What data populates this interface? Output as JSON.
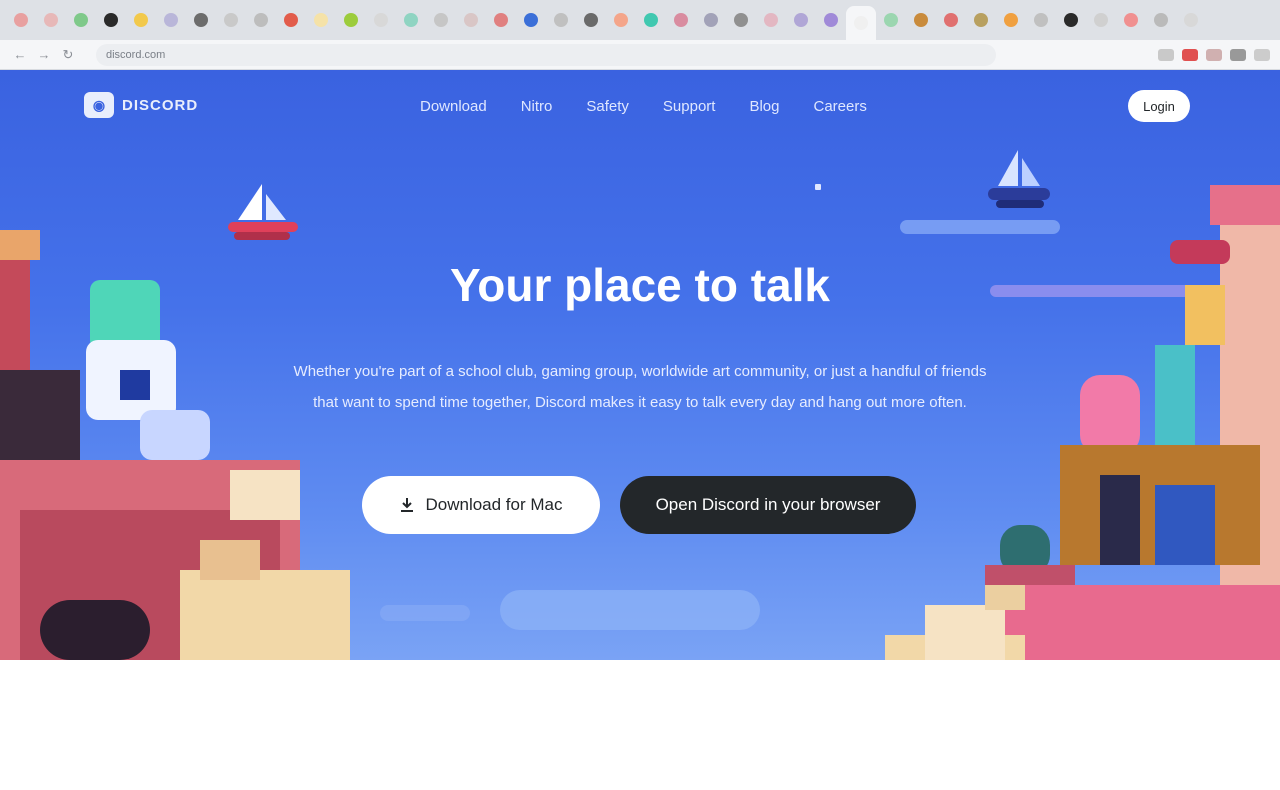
{
  "browser": {
    "tab_favicons": [
      "#e8a0a0",
      "#e7b8b8",
      "#7fc98a",
      "#2a2a2a",
      "#f2c94c",
      "#b9b6d9",
      "#6c6c6c",
      "#c9c9c9",
      "#bdbdbd",
      "#e25c4b",
      "#f5e2a8",
      "#9ccc3c",
      "#d8d8d8",
      "#8fd4c2",
      "#c6c6c6",
      "#d9c6c6",
      "#e08080",
      "#3b6fd8",
      "#c0c0c0",
      "#6a6a6a",
      "#f4a58a",
      "#40c8b0",
      "#d98ca0",
      "#a2a2b8",
      "#909090",
      "#e3b7c2",
      "#b0a6d6",
      "#a08ad8",
      "#f0f0f0",
      "#9bd6b0",
      "#c98b3c",
      "#e07070",
      "#b8a060",
      "#f0a040",
      "#c0c0c0",
      "#2a2a2a",
      "#d0d0d0",
      "#f09090",
      "#bababa",
      "#d8d8d8"
    ],
    "active_tab_index": 28,
    "url": "discord.com",
    "extension_colors": [
      "#c9c9c9",
      "#e05050",
      "#d0b0b0",
      "#999999",
      "#cccccc"
    ]
  },
  "site": {
    "logo_text": "DISCORD",
    "nav": [
      "Download",
      "Nitro",
      "Safety",
      "Support",
      "Blog",
      "Careers"
    ],
    "login_label": "Login"
  },
  "hero": {
    "title": "Your place to talk",
    "subtitle": "Whether you're part of a school club, gaming group, worldwide art community, or just a handful of friends that want to spend time together, Discord makes it easy to talk every day and hang out more often.",
    "download_label": "Download for Mac",
    "open_label": "Open Discord in your browser"
  },
  "colors": {
    "hero_top": "#3a62e0",
    "hero_bottom": "#7aa3f5",
    "dark_button": "#23272a",
    "light_button": "#ffffff"
  }
}
